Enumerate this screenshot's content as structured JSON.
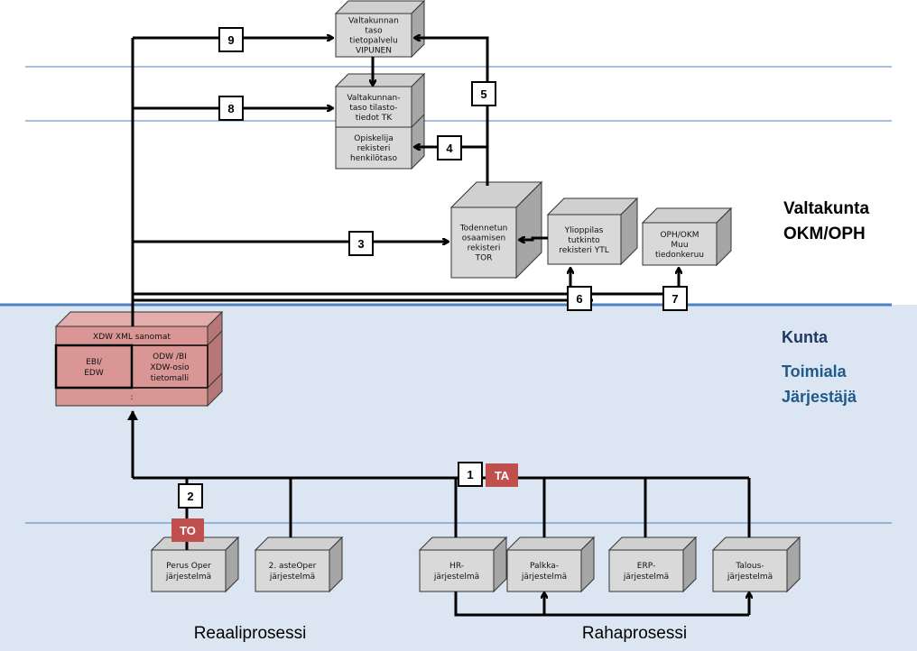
{
  "colors": {
    "lower_band": "#dce6f2",
    "divider": "#4f81bd",
    "cube_gray": "#d9d9d9",
    "cube_red": "#d99694",
    "tag_red": "#c0504d",
    "kunta": "#1f3864",
    "toimiala": "#1f5a8c"
  },
  "levels": {
    "valtakunta": "Valtakunta",
    "okm_oph": "OKM/OPH",
    "kunta": "Kunta",
    "toimiala": "Toimiala",
    "jarjestaja": "Järjestäjä"
  },
  "boxes": {
    "vipunen": [
      "Valtakunnan",
      "taso",
      "tietopalvelu",
      "VIPUNEN"
    ],
    "tk": [
      "Valtakunnan-",
      "taso tilasto-",
      "tiedot TK"
    ],
    "opiskelija": [
      "Opiskelija",
      "rekisteri",
      "henkilötaso"
    ],
    "tor": [
      "Todennetun",
      "osaamisen",
      "rekisteri",
      "TOR"
    ],
    "ytl": [
      "Ylioppilas",
      "tutkinto",
      "rekisteri YTL"
    ],
    "oph": [
      "OPH/OKM",
      "Muu",
      "tiedonkeruu"
    ],
    "xdw": {
      "top": "XDW XML sanomat",
      "left": [
        "EBI/",
        "EDW"
      ],
      "right": [
        "ODW  /BI",
        "XDW-osio",
        "tietomalli"
      ],
      "bottom": ":"
    },
    "perus": [
      "Perus Oper",
      "järjestelmä"
    ],
    "toinen": [
      "2. asteOper",
      "järjestelmä"
    ],
    "hr": [
      "HR-",
      "järjestelmä"
    ],
    "palkka": [
      "Palkka-",
      "järjestelmä"
    ],
    "erp": [
      "ERP-",
      "järjestelmä"
    ],
    "talous": [
      "Talous-",
      "järjestelmä"
    ]
  },
  "flows": {
    "f1": "1",
    "f2": "2",
    "f3": "3",
    "f4": "4",
    "f5": "5",
    "f6": "6",
    "f7": "7",
    "f8": "8",
    "f9": "9"
  },
  "tags": {
    "ta": "TA",
    "to": "TO"
  },
  "processes": {
    "reaali": "Reaaliprosessi",
    "raha": "Rahaprosessi"
  }
}
